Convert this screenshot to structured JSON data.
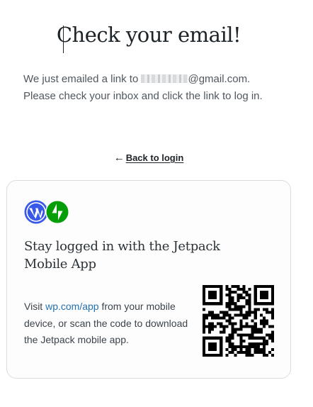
{
  "header": {
    "title": "Check your email!"
  },
  "message": {
    "prefix": "We just emailed a link to",
    "email_suffix": "@gmail.com.",
    "rest": "Please check your inbox and click the link to log in."
  },
  "back_link": {
    "icon": "arrow-left-icon",
    "label": "Back to login"
  },
  "app_card": {
    "logos": [
      "wordpress-logo-icon",
      "jetpack-logo-icon"
    ],
    "title": "Stay logged in with the Jetpack Mobile App",
    "desc_prefix": "Visit",
    "link_text": "wp.com/app",
    "desc_suffix": "from your mobile device, or scan the code to download the Jetpack mobile app.",
    "qr_icon": "qr-code-icon"
  },
  "colors": {
    "wordpress_blue": "#3858e9",
    "jetpack_green": "#069e08",
    "link_blue": "#2271b1"
  }
}
